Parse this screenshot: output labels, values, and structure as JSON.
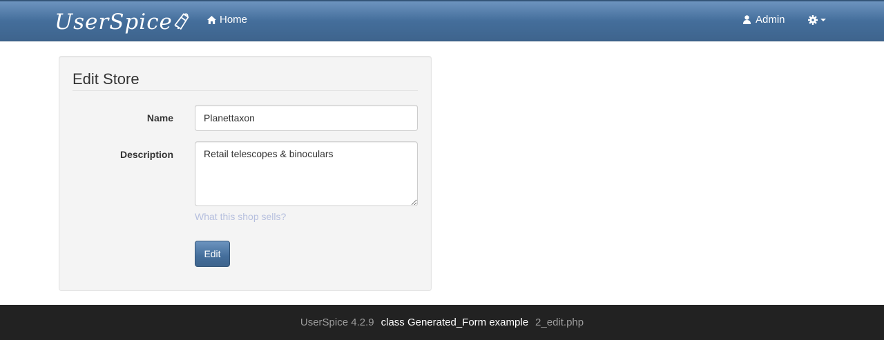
{
  "navbar": {
    "brand": "UserSpice",
    "home_label": "Home",
    "user_label": "Admin",
    "icons": {
      "home": "home-icon",
      "user": "user-icon",
      "settings": "gear-icon"
    }
  },
  "form": {
    "title": "Edit Store",
    "name_label": "Name",
    "name_value": "Planettaxon",
    "description_label": "Description",
    "description_value": "Retail telescopes & binoculars",
    "description_help": "What this shop sells?",
    "submit_label": "Edit"
  },
  "footer": {
    "version": "UserSpice 4.2.9",
    "example": "class Generated_Form example",
    "file": "2_edit.php"
  },
  "colors": {
    "navbar": "#446e9b",
    "button": "#446e9b",
    "help_text": "#b6bfde",
    "footer_bg": "#222222"
  }
}
